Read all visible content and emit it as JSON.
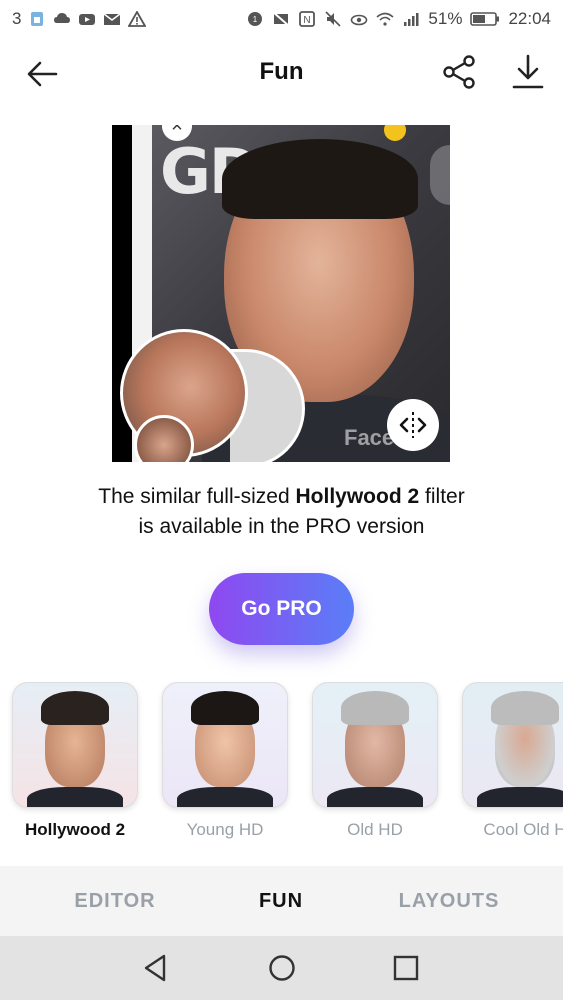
{
  "status_bar": {
    "notification_count": "3",
    "battery": "51%",
    "time": "22:04"
  },
  "header": {
    "title": "Fun"
  },
  "preview": {
    "background_text": "GDE",
    "watermark": "Face"
  },
  "pro_message": {
    "line1_prefix": "The similar full-sized ",
    "filter_name": "Hollywood 2",
    "line1_suffix": " filter",
    "line2": "is available in the PRO version"
  },
  "go_pro_button": "Go PRO",
  "filters": [
    {
      "label": "Hollywood 2",
      "selected": true
    },
    {
      "label": "Young HD",
      "selected": false
    },
    {
      "label": "Old HD",
      "selected": false
    },
    {
      "label": "Cool Old H",
      "selected": false
    }
  ],
  "tabs": [
    {
      "label": "EDITOR",
      "active": false
    },
    {
      "label": "FUN",
      "active": true
    },
    {
      "label": "LAYOUTS",
      "active": false
    }
  ],
  "colors": {
    "gopro_gradient_start": "#8f48f0",
    "gopro_gradient_end": "#5a7ef7",
    "inactive_text": "#9aa0a8",
    "active_text": "#111111"
  }
}
